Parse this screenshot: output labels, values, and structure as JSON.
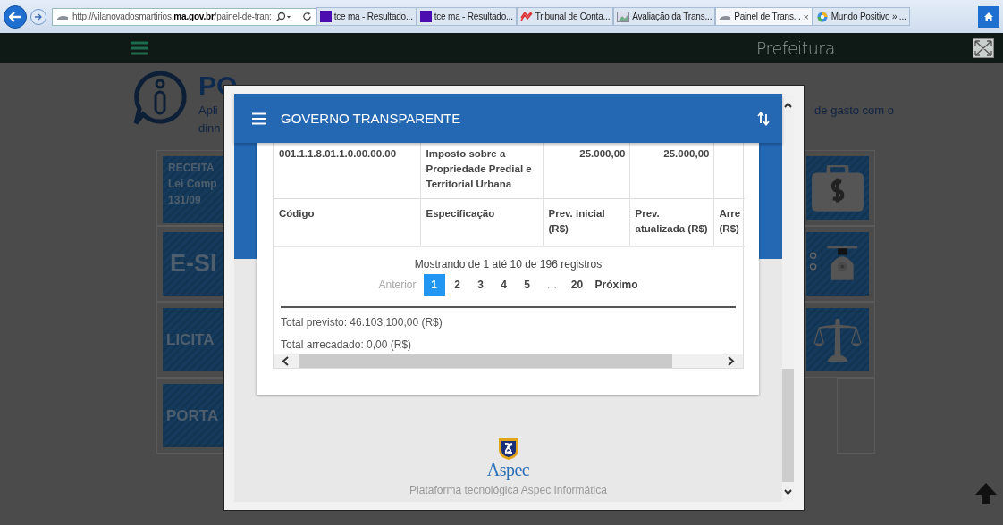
{
  "browser": {
    "address": "http://vilanovadosmartirios.**ma.gov.br**/painel-de-tran:",
    "tabs": [
      {
        "title": "tce ma - Resultado...",
        "kind": "square",
        "selected": false
      },
      {
        "title": "tce ma - Resultado...",
        "kind": "square",
        "selected": false
      },
      {
        "title": "Tribunal de Conta...",
        "kind": "chart",
        "selected": false
      },
      {
        "title": "Avaliação da Trans...",
        "kind": "image",
        "selected": false
      },
      {
        "title": "Painel de Trans...",
        "kind": "site",
        "selected": true,
        "close": "×"
      },
      {
        "title": "Mundo Positivo » ...",
        "kind": "globe",
        "selected": false
      }
    ]
  },
  "site_bar": {
    "title": "Prefeitura"
  },
  "portal": {
    "title": "PO",
    "intro_left": [
      "Apli",
      "dinh"
    ],
    "intro_right": "de gasto com o",
    "left_tiles": [
      {
        "lines": [
          "RECEITA",
          "Lei Comp",
          "131/09"
        ],
        "kind": "small"
      },
      {
        "lines": [
          "E-SI"
        ],
        "kind": "large"
      },
      {
        "lines": [
          "LICITA"
        ],
        "kind": "medium"
      },
      {
        "lines": [
          "PORTA"
        ],
        "kind": "medium"
      }
    ],
    "right_tiles": [
      {
        "kind": "money"
      },
      {
        "kind": "scale"
      },
      {
        "kind": "justice"
      },
      {
        "kind": "empty"
      }
    ]
  },
  "modal": {
    "title": "GOVERNO TRANSPARENTE",
    "table": {
      "rows": [
        [
          "001.1.1.8.01.1.0.00.00.00",
          "Imposto sobre a Propriedade Predial e Territorial Urbana",
          "25.000,00",
          "25.000,00"
        ]
      ],
      "footer_columns": [
        "Código",
        "Especificação",
        "Prev. inicial (R$)",
        "Prev. atualizada (R$)",
        "Arre (R$)"
      ]
    },
    "pagination": {
      "summary": "Mostrando de 1 até 10 de 196 registros",
      "previous": {
        "label": "Anterior",
        "disabled": true
      },
      "pages": [
        {
          "label": "1",
          "selected": true
        },
        {
          "label": "2",
          "selected": false
        },
        {
          "label": "3",
          "selected": false
        },
        {
          "label": "4",
          "selected": false
        },
        {
          "label": "5",
          "selected": false
        },
        {
          "label": "…",
          "kind": "gap"
        },
        {
          "label": "20",
          "selected": false
        }
      ],
      "next": {
        "label": "Próximo",
        "disabled": false
      }
    },
    "totals": [
      "Total previsto: 46.103.100,00 (R$)",
      "Total arrecadado: 0,00 (R$)"
    ],
    "footer": {
      "logo_text": "Aspec",
      "caption": "Plataforma tecnológica Aspec Informática"
    }
  }
}
